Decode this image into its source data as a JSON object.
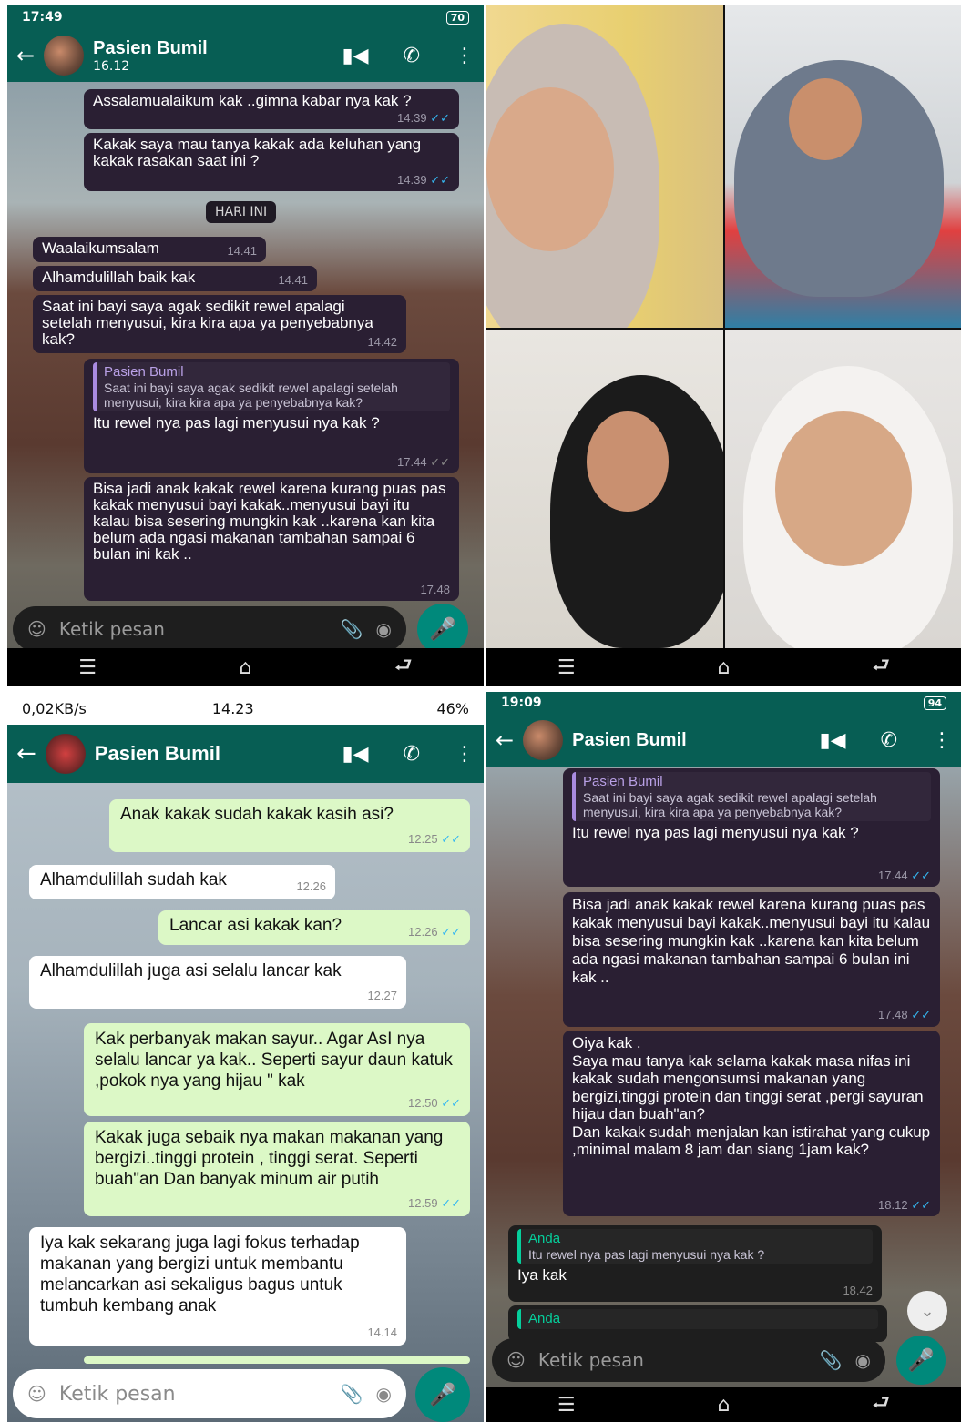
{
  "p1": {
    "status_time": "17:49",
    "battery": "70",
    "contact": "Pasien Bumil",
    "last_seen": "16.12",
    "date_chip": "HARI INI",
    "input_placeholder": "Ketik pesan",
    "messages": [
      {
        "text": "Assalamualaikum kak ..gimna kabar nya kak ?",
        "time": "14.39"
      },
      {
        "text": "Kakak saya mau tanya kakak ada keluhan yang kakak rasakan saat ini ?",
        "time": "14.39"
      },
      {
        "text": "Waalaikumsalam",
        "time": "14.41"
      },
      {
        "text": "Alhamdulillah baik kak",
        "time": "14.41"
      },
      {
        "text": "Saat ini bayi saya agak sedikit rewel apalagi setelah menyusui, kira kira apa ya penyebabnya kak?",
        "time": "14.42"
      },
      {
        "quote_name": "Pasien Bumil",
        "quote_text": "Saat ini bayi saya agak sedikit rewel apalagi setelah menyusui, kira kira apa ya penyebabnya kak?",
        "text": "Itu rewel nya pas lagi menyusui nya kak ?",
        "time": "17.44"
      },
      {
        "text": "Bisa jadi anak kakak rewel karena kurang puas pas kakak menyusui bayi kakak..menyusui bayi itu kalau bisa sesering mungkin kak ..karena kan kita belum ada ngasi makanan tambahan sampai 6 bulan ini kak ..",
        "time": "17.48"
      }
    ]
  },
  "p3": {
    "network": "0,02KB/s",
    "status_time": "14.23",
    "battery": "46%",
    "contact": "Pasien Bumil",
    "input_placeholder": "Ketik pesan",
    "messages": [
      {
        "text": "Anak kakak sudah kakak kasih asi?",
        "time": "12.25"
      },
      {
        "text": "Alhamdulillah sudah kak",
        "time": "12.26"
      },
      {
        "text": "Lancar asi kakak kan?",
        "time": "12.26"
      },
      {
        "text": "Alhamdulillah  juga asi selalu lancar kak",
        "time": "12.27"
      },
      {
        "text": "Kak perbanyak makan sayur.. Agar AsI nya selalu lancar ya kak.. Seperti sayur daun katuk ,pokok nya yang hijau \" kak",
        "time": "12.50"
      },
      {
        "text": "Kakak juga sebaik nya makan makanan yang bergizi..tinggi protein , tinggi serat. Seperti buah\"an Dan banyak minum air putih",
        "time": "12.59"
      },
      {
        "text": "Iya kak sekarang juga lagi fokus terhadap makanan yang bergizi untuk membantu melancarkan asi sekaligus bagus untuk tumbuh kembang anak",
        "time": "14.14"
      }
    ]
  },
  "p4": {
    "status_time": "19:09",
    "battery": "94",
    "contact": "Pasien Bumil",
    "input_placeholder": "Ketik pesan",
    "messages": [
      {
        "quote_name": "Pasien Bumil",
        "quote_text": "Saat ini bayi saya agak sedikit rewel apalagi setelah menyusui, kira kira apa ya penyebabnya kak?",
        "text": "Itu rewel nya pas lagi menyusui nya kak ?",
        "time": "17.44"
      },
      {
        "text": "Bisa jadi anak kakak rewel karena kurang puas pas kakak menyusui bayi kakak..menyusui bayi itu kalau bisa sesering mungkin kak ..karena kan kita belum ada ngasi makanan tambahan sampai 6 bulan ini kak ..",
        "time": "17.48"
      },
      {
        "text": "Oiya kak .\nSaya mau tanya kak selama kakak masa nifas ini kakak sudah mengonsumsi makanan yang bergizi,tinggi protein dan tinggi serat ,pergi sayuran hijau dan buah\"an?\nDan kakak sudah menjalan kan istirahat yang cukup ,minimal malam 8 jam dan siang 1jam kak?",
        "time": "18.12"
      },
      {
        "quote_name": "Anda",
        "quote_text": "Itu rewel nya pas lagi menyusui nya kak ?",
        "text": "Iya kak",
        "time": "18.42"
      },
      {
        "quote_name": "Anda",
        "quote_text": "",
        "text": "",
        "time": ""
      }
    ]
  },
  "colors": {
    "header": "#075e54",
    "accent": "#00897b",
    "outgoing_dark": "#2a1f33",
    "outgoing_green": "#dcf8c6"
  },
  "icons": [
    "back-arrow-icon",
    "video-call-icon",
    "phone-icon",
    "more-vert-icon",
    "emoji-icon",
    "attach-icon",
    "camera-icon",
    "mic-icon",
    "menu-icon",
    "home-icon",
    "back-icon",
    "double-check-icon"
  ]
}
